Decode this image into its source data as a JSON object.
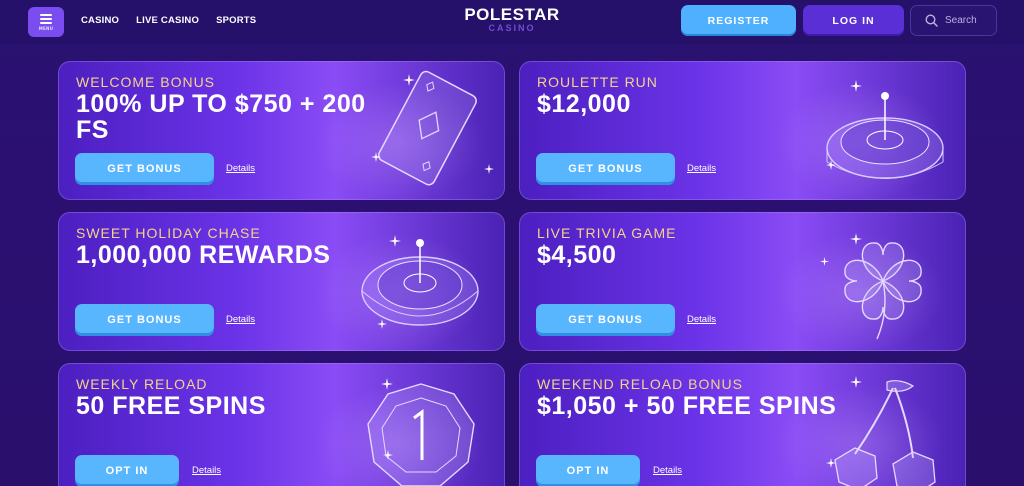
{
  "header": {
    "menu_label": "MENU",
    "nav": [
      "CASINO",
      "LIVE CASINO",
      "SPORTS"
    ],
    "logo_main": "POLESTAR",
    "logo_sub": "CASINO",
    "register_label": "REGISTER",
    "login_label": "LOG IN",
    "search_label": "Search"
  },
  "cards": [
    {
      "kicker": "WELCOME BONUS",
      "headline": "100% UP TO $750 + 200 FS",
      "cta": "GET BONUS",
      "details": "Details",
      "art": "card-icon"
    },
    {
      "kicker": "ROULETTE RUN",
      "headline": "$12,000",
      "cta": "GET BONUS",
      "details": "Details",
      "art": "roulette-wheel-icon"
    },
    {
      "kicker": "SWEET HOLIDAY CHASE",
      "headline": "1,000,000 REWARDS",
      "cta": "GET BONUS",
      "details": "Details",
      "art": "roulette-wheel-icon"
    },
    {
      "kicker": "LIVE TRIVIA GAME",
      "headline": "$4,500",
      "cta": "GET BONUS",
      "details": "Details",
      "art": "clover-icon"
    },
    {
      "kicker": "WEEKLY RELOAD",
      "headline": "50 FREE SPINS",
      "cta": "OPT IN",
      "details": "Details",
      "art": "coin-icon"
    },
    {
      "kicker": "WEEKEND RELOAD BONUS",
      "headline": "$1,050 + 50 FREE SPINS",
      "cta": "OPT IN",
      "details": "Details",
      "art": "cherries-icon"
    }
  ],
  "colors": {
    "background": "#2a1270",
    "accent_blue": "#58b6ff",
    "accent_purple": "#5a2fd6",
    "kicker_gold": "#f3d48a"
  }
}
